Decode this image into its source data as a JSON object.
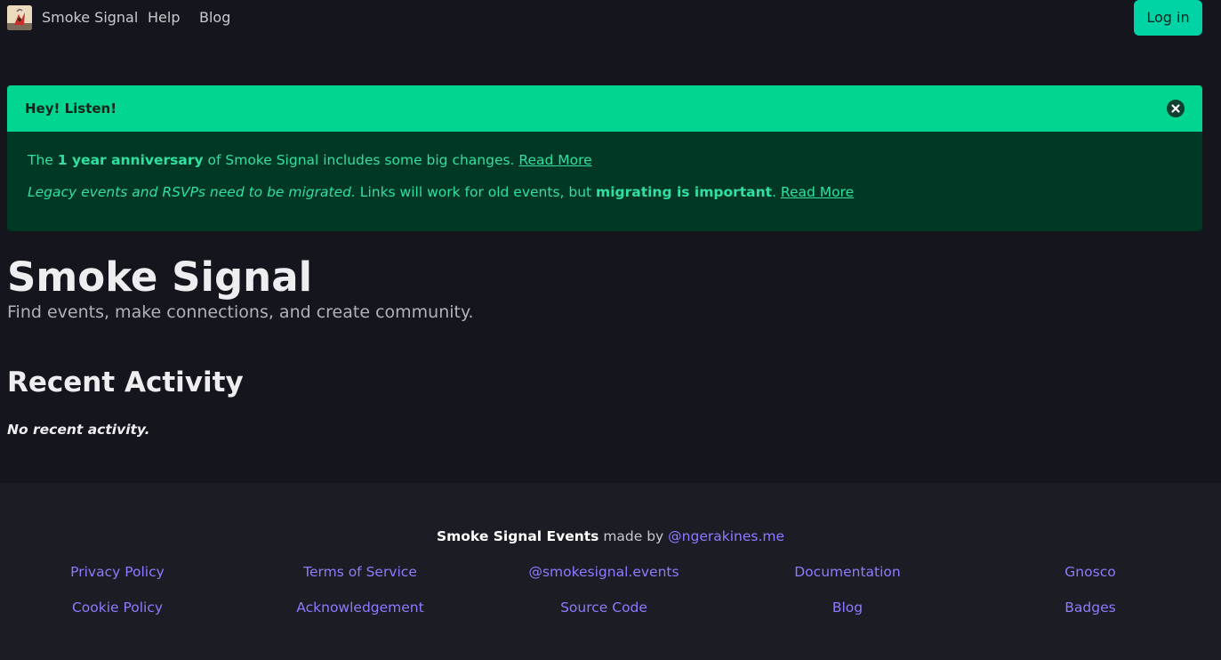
{
  "navbar": {
    "brand": "Smoke Signal",
    "help": "Help",
    "blog": "Blog",
    "login": "Log in"
  },
  "notice": {
    "title": "Hey! Listen!",
    "line1_prefix": "The ",
    "line1_bold": "1 year anniversary",
    "line1_suffix": " of Smoke Signal includes some big changes. ",
    "line1_link": "Read More",
    "line2_italic": "Legacy events and RSVPs need to be migrated.",
    "line2_middle": " Links will work for old events, but ",
    "line2_bold": "migrating is important",
    "line2_period": ". ",
    "line2_link": "Read More"
  },
  "hero": {
    "title": "Smoke Signal",
    "subtitle": "Find events, make connections, and create community."
  },
  "activity": {
    "title": "Recent Activity",
    "empty": "No recent activity."
  },
  "footer": {
    "credit_name": "Smoke Signal Events",
    "credit_madeby": " made by ",
    "credit_author": "@ngerakines.me",
    "links_row1": [
      "Privacy Policy",
      "Terms of Service",
      "@smokesignal.events",
      "Documentation",
      "Gnosco"
    ],
    "links_row2": [
      "Cookie Policy",
      "Acknowledgement",
      "Source Code",
      "Blog",
      "Badges"
    ]
  },
  "colors": {
    "background": "#15161d",
    "accent": "#00d4a6",
    "notice_header": "#00d691",
    "notice_body": "#003826",
    "link": "#8c7bff"
  },
  "icons": {
    "logo": "smoke-signal-logo-icon",
    "close": "close-circle-icon"
  }
}
